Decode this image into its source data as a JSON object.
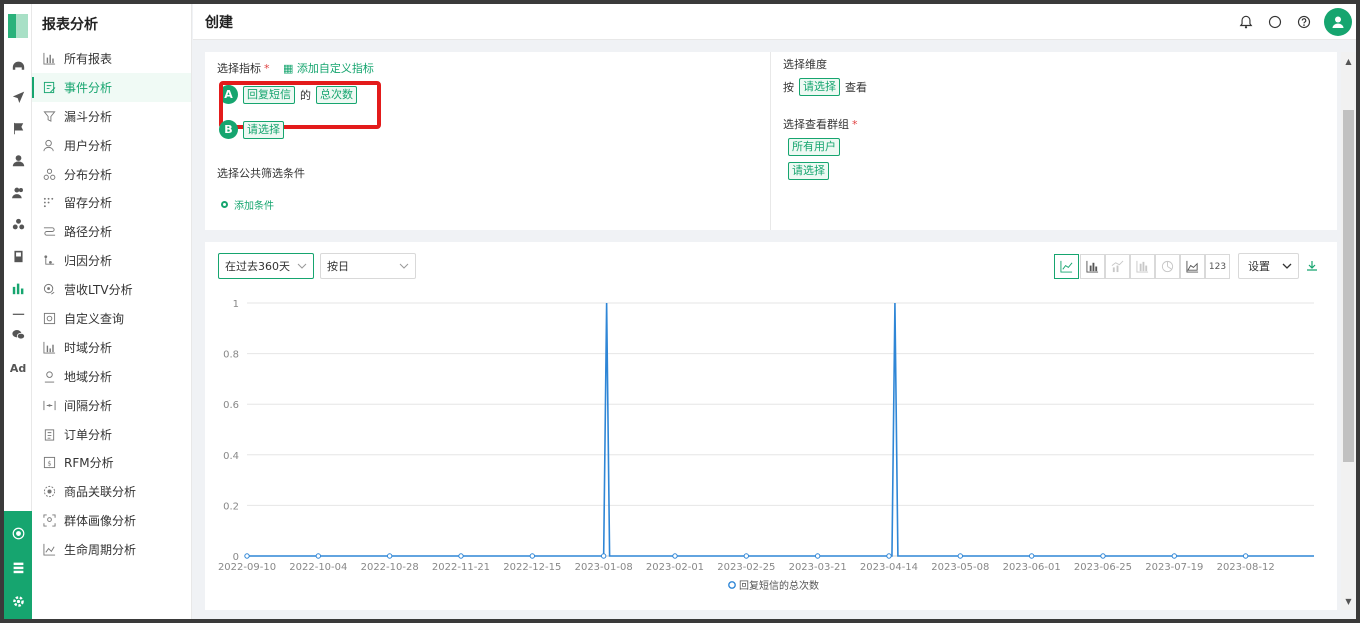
{
  "app": {
    "section_title": "报表分析"
  },
  "header": {
    "title": "创建"
  },
  "menu": {
    "items": [
      {
        "label": "所有报表",
        "icon": "bar-chart-icon",
        "active": false
      },
      {
        "label": "事件分析",
        "icon": "edit-doc-icon",
        "active": true
      },
      {
        "label": "漏斗分析",
        "icon": "funnel-icon",
        "active": false
      },
      {
        "label": "用户分析",
        "icon": "user-icon",
        "active": false
      },
      {
        "label": "分布分析",
        "icon": "distribution-icon",
        "active": false
      },
      {
        "label": "留存分析",
        "icon": "dots-grid-icon",
        "active": false
      },
      {
        "label": "路径分析",
        "icon": "path-icon",
        "active": false
      },
      {
        "label": "归因分析",
        "icon": "attribution-icon",
        "active": false
      },
      {
        "label": "营收LTV分析",
        "icon": "coin-user-icon",
        "active": false
      },
      {
        "label": "自定义查询",
        "icon": "query-icon",
        "active": false
      },
      {
        "label": "时域分析",
        "icon": "time-bars-icon",
        "active": false
      },
      {
        "label": "地域分析",
        "icon": "location-icon",
        "active": false
      },
      {
        "label": "间隔分析",
        "icon": "interval-icon",
        "active": false
      },
      {
        "label": "订单分析",
        "icon": "clipboard-icon",
        "active": false
      },
      {
        "label": "RFM分析",
        "icon": "rfm-icon",
        "active": false
      },
      {
        "label": "商品关联分析",
        "icon": "association-icon",
        "active": false
      },
      {
        "label": "群体画像分析",
        "icon": "portrait-icon",
        "active": false
      },
      {
        "label": "生命周期分析",
        "icon": "lifecycle-icon",
        "active": false
      }
    ]
  },
  "rail": {
    "ad_label": "Ad"
  },
  "query": {
    "metric_label": "选择指标",
    "add_custom": "添加自定义指标",
    "metric_a": {
      "letter": "A",
      "event": "回复短信",
      "connector": "的",
      "measure": "总次数"
    },
    "metric_b": {
      "letter": "B",
      "placeholder": "请选择"
    },
    "filter_label": "选择公共筛选条件",
    "add_condition": "添加条件",
    "dimension_label": "选择维度",
    "by_prefix": "按",
    "by_select": "请选择",
    "by_suffix": "查看",
    "group_label": "选择查看群组",
    "group_all": "所有用户",
    "group_select": "请选择"
  },
  "controls": {
    "range": "在过去360天",
    "granularity": "按日",
    "settings": "设置",
    "number_view": "123"
  },
  "colors": {
    "accent": "#16a56f",
    "line": "#2f86d6",
    "highlight_box": "#e31b1b"
  },
  "chart_data": {
    "type": "line",
    "x_ticks": [
      "2022-09-10",
      "2022-10-04",
      "2022-10-28",
      "2022-11-21",
      "2022-12-15",
      "2023-01-08",
      "2023-02-01",
      "2023-02-25",
      "2023-03-21",
      "2023-04-14",
      "2023-05-08",
      "2023-06-01",
      "2023-06-25",
      "2023-07-19",
      "2023-08-12"
    ],
    "y_ticks": [
      "0",
      "0.2",
      "0.4",
      "0.6",
      "0.8",
      "1"
    ],
    "ylim": [
      0,
      1
    ],
    "series": [
      {
        "name": "回复短信的总次数",
        "points": [
          {
            "date": "2023-01-09",
            "value": 1
          },
          {
            "date": "2023-04-16",
            "value": 1
          }
        ],
        "default_value": 0
      }
    ],
    "legend": "bottom-center"
  }
}
